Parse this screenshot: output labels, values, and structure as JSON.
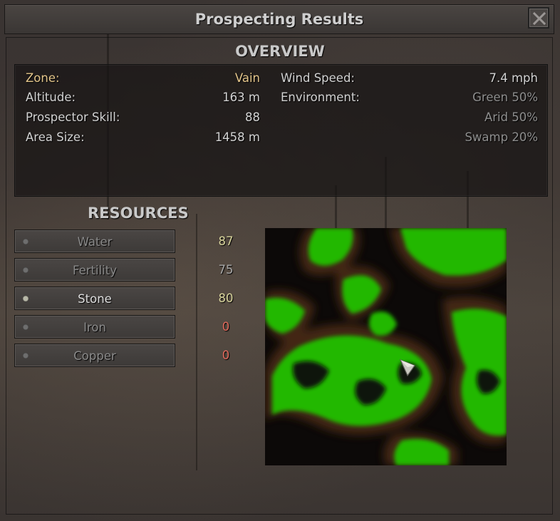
{
  "window": {
    "title": "Prospecting Results",
    "close_icon": "close-x-icon"
  },
  "overview": {
    "heading": "OVERVIEW",
    "zone_label": "Zone:",
    "zone_value": "Vain",
    "altitude_label": "Altitude:",
    "altitude_value": "163 m",
    "skill_label": "Prospector Skill:",
    "skill_value": "88",
    "area_label": "Area Size:",
    "area_value": "1458 m",
    "wind_label": "Wind Speed:",
    "wind_value": "7.4 mph",
    "environment_label": "Environment:",
    "environment": [
      "Green 50%",
      "Arid 50%",
      "Swamp 20%"
    ]
  },
  "resources": {
    "heading": "RESOURCES",
    "items": [
      {
        "label": "Water",
        "value": "87",
        "active": false,
        "value_color": "#d8d49c"
      },
      {
        "label": "Fertility",
        "value": "75",
        "active": false,
        "value_color": "#a8a8a8"
      },
      {
        "label": "Stone",
        "value": "80",
        "active": true,
        "value_color": "#d8d49c"
      },
      {
        "label": "Iron",
        "value": "0",
        "active": false,
        "value_color": "#e06a5c"
      },
      {
        "label": "Copper",
        "value": "0",
        "active": false,
        "value_color": "#e06a5c"
      }
    ]
  },
  "map": {
    "high_color": "#20b800",
    "low_color": "#0c0908",
    "player_marker_icon": "player-arrow-icon"
  }
}
